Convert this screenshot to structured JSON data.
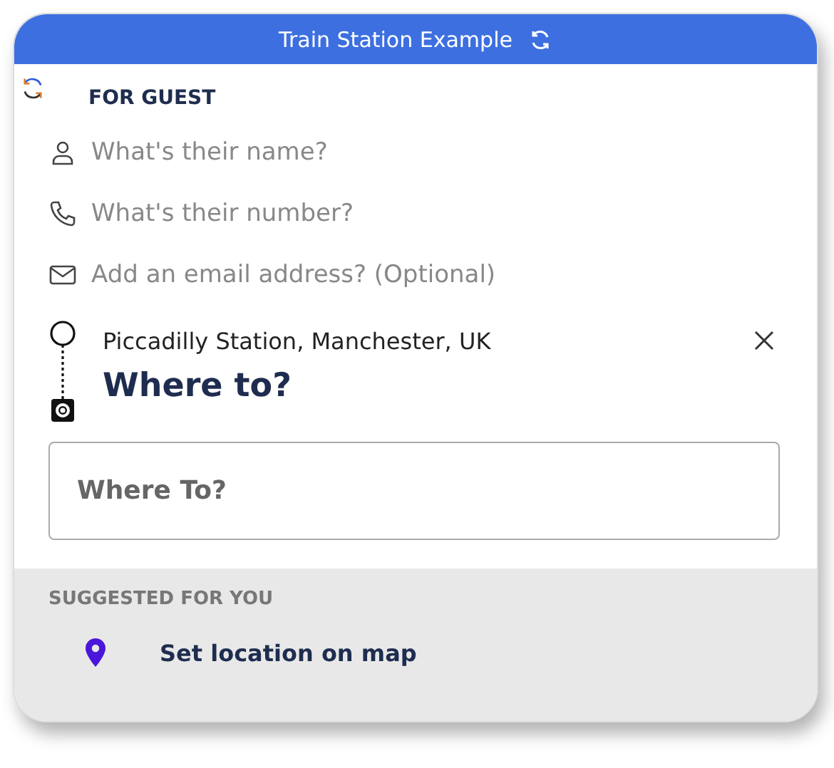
{
  "header": {
    "title": "Train Station Example"
  },
  "section_title": "FOR GUEST",
  "guest_fields": [
    {
      "kind": "person",
      "placeholder": "What's their name?"
    },
    {
      "kind": "phone",
      "placeholder": "What's their number?"
    },
    {
      "kind": "email",
      "placeholder": "Add an email address? (Optional)"
    }
  ],
  "route": {
    "origin": "Piccadilly Station, Manchester, UK",
    "destination_heading": "Where to?"
  },
  "destination_field": {
    "placeholder": "Where To?"
  },
  "suggestions": {
    "title": "SUGGESTED FOR YOU",
    "items": [
      {
        "label": "Set location on map"
      }
    ]
  }
}
